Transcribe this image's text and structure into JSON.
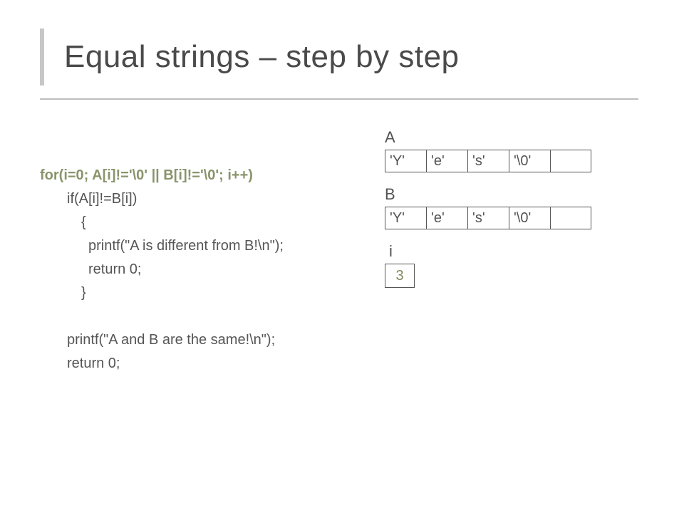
{
  "title": "Equal strings – step by step",
  "code": {
    "for_line": "for(i=0; A[i]!='\\0' || B[i]!='\\0'; i++)",
    "if_line": "if(A[i]!=B[i])",
    "brace_open": "{",
    "printf_diff": "printf(\"A is different from B!\\n\");",
    "return0_a": "return 0;",
    "brace_close": "}",
    "printf_same": "printf(\"A and B are the same!\\n\");",
    "return0_b": "return 0;"
  },
  "vars": {
    "A_label": "A",
    "A": [
      "'Y'",
      "'e'",
      "'s'",
      "'\\0'",
      ""
    ],
    "B_label": "B",
    "B": [
      "'Y'",
      "'e'",
      "'s'",
      "'\\0'",
      ""
    ],
    "i_label": "i",
    "i_value": "3"
  }
}
